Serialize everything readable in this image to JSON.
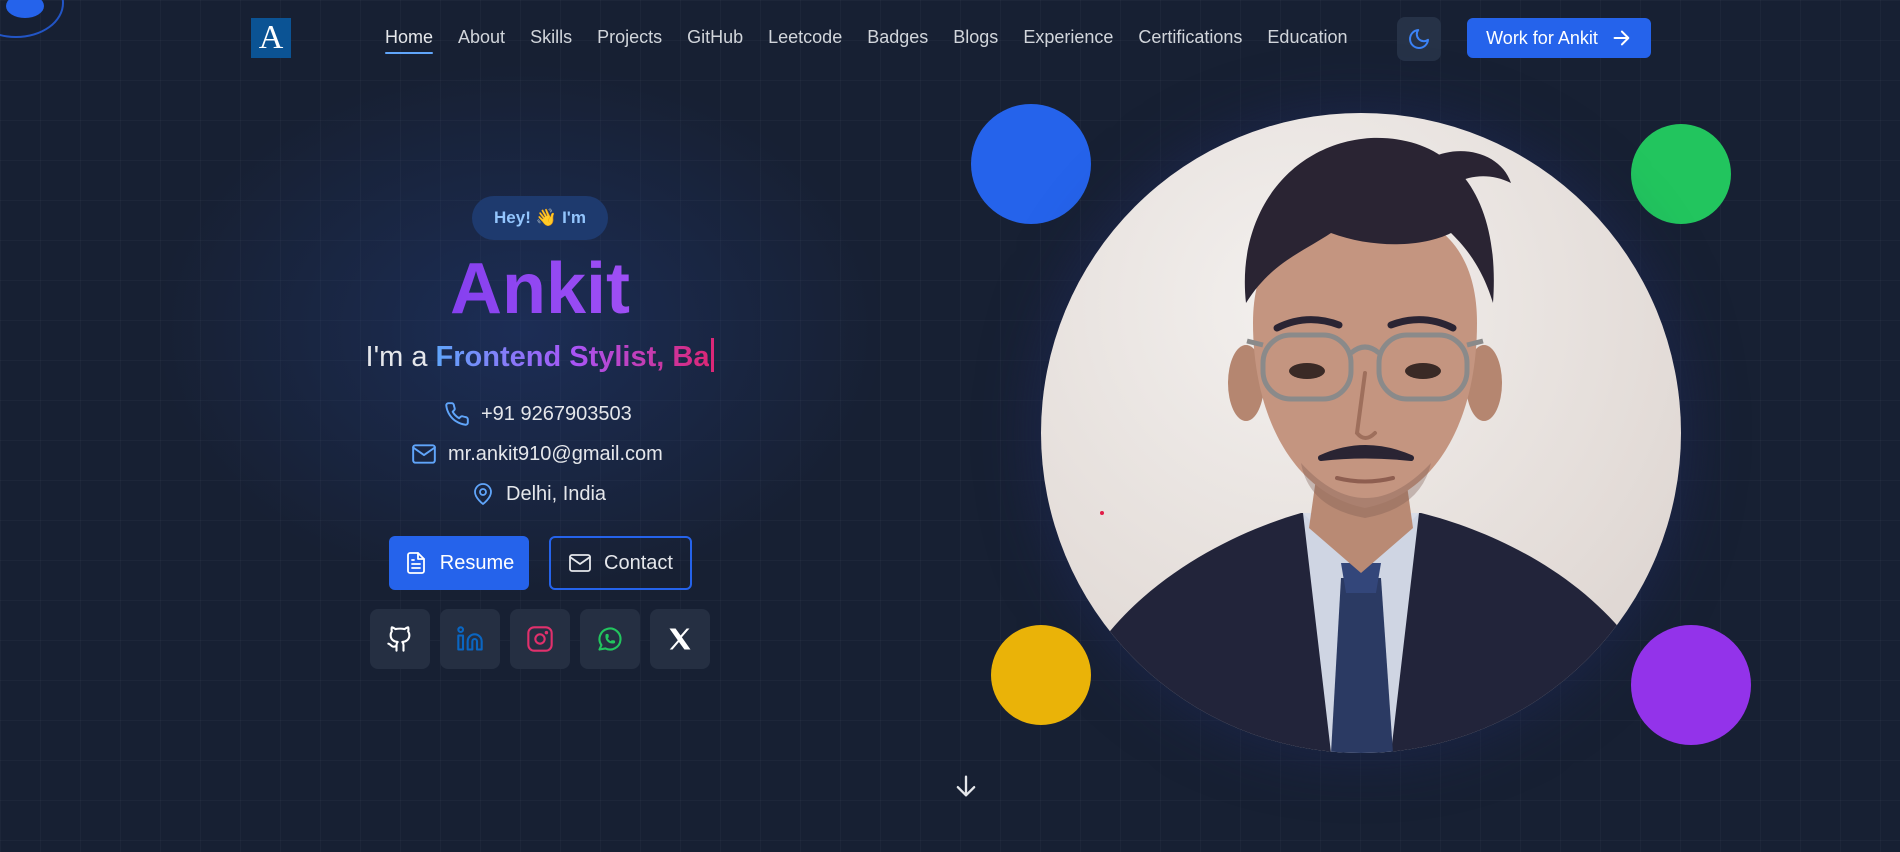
{
  "navbar": {
    "logo_text": "A",
    "links": [
      {
        "label": "Home",
        "active": true
      },
      {
        "label": "About"
      },
      {
        "label": "Skills"
      },
      {
        "label": "Projects"
      },
      {
        "label": "GitHub"
      },
      {
        "label": "Leetcode"
      },
      {
        "label": "Badges"
      },
      {
        "label": "Blogs"
      },
      {
        "label": "Experience"
      },
      {
        "label": "Certifications"
      },
      {
        "label": "Education"
      }
    ],
    "theme_icon": "moon-icon",
    "cta_label": "Work for Ankit",
    "cta_icon": "arrow-right-icon"
  },
  "hero": {
    "greeting_text": "Hey!",
    "greeting_emoji": "👋",
    "greeting_suffix": "I'm",
    "name": "Ankit",
    "role_prefix": "I'm a",
    "role_typed": "Frontend Stylist, Ba",
    "contacts": {
      "phone": "+91 9267903503",
      "email": "mr.ankit910@gmail.com",
      "location": "Delhi, India"
    },
    "buttons": {
      "resume": "Resume",
      "contact": "Contact"
    },
    "socials": [
      "github-icon",
      "linkedin-icon",
      "instagram-icon",
      "whatsapp-icon",
      "x-icon"
    ],
    "scroll_icon": "arrow-down-icon"
  },
  "colors": {
    "background": "#172033",
    "accent": "#2563eb",
    "circle_blue": "#2563eb",
    "circle_green": "#22c55e",
    "circle_yellow": "#eab308",
    "circle_purple": "#9333ea"
  }
}
